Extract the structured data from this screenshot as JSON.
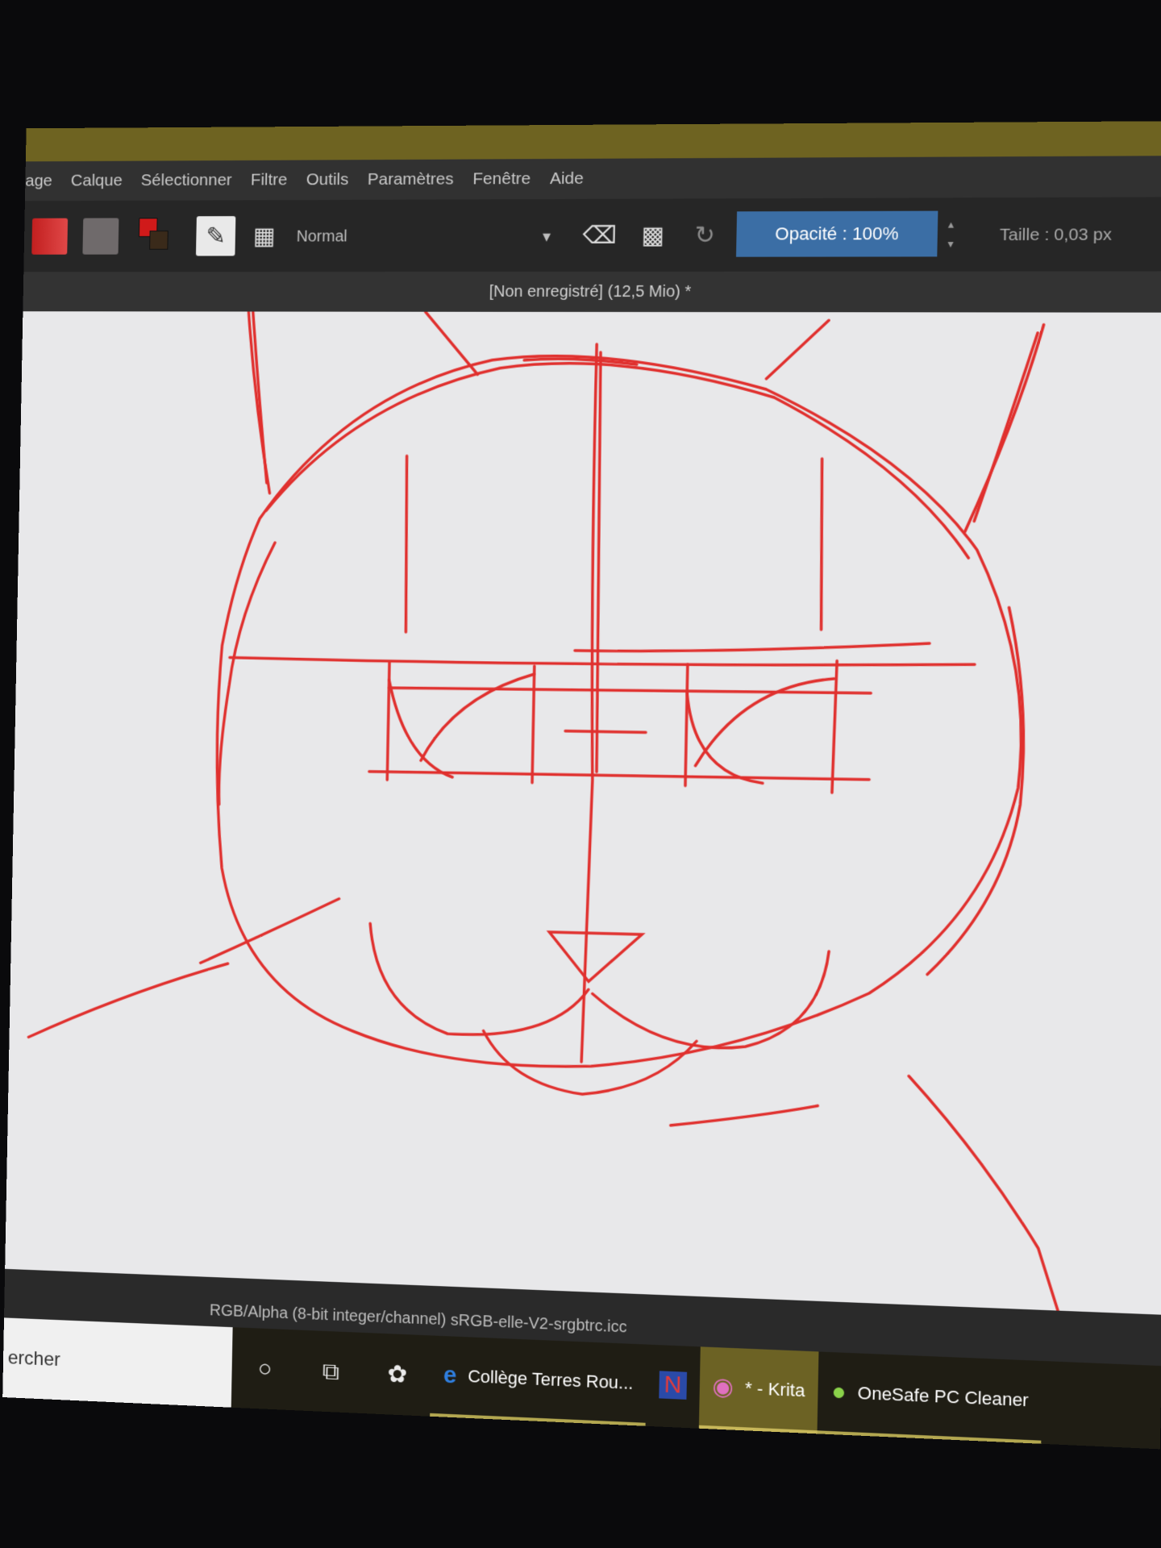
{
  "menubar": {
    "items": [
      "age",
      "Calque",
      "Sélectionner",
      "Filtre",
      "Outils",
      "Paramètres",
      "Fenêtre",
      "Aide"
    ]
  },
  "toolbar": {
    "blend_mode": "Normal",
    "opacity_label": "Opacité : 100%",
    "size_label": "Taille : 0,03 px",
    "icons": [
      "gradient-swatch",
      "pattern-swatch",
      "fg-bg-color-icon",
      "brush-preset-icon",
      "preset-grid-icon",
      "eraser-icon",
      "alpha-lock-icon",
      "reload-icon"
    ]
  },
  "document": {
    "title": "[Non enregistré]  (12,5 Mio) *"
  },
  "colors": {
    "accent": "#6e6321",
    "opacity_bg": "#3b6ea5",
    "stroke": "#e0302e",
    "canvas": "#e8e8ea"
  },
  "statusbar": {
    "color_profile": "RGB/Alpha (8-bit integer/channel)  sRGB-elle-V2-srgbtrc.icc"
  },
  "taskbar": {
    "search_text": "ercher",
    "apps": [
      {
        "label": "Collège Terres Rou...",
        "icon": "edge-icon"
      },
      {
        "label": "",
        "icon": "netflix-icon"
      },
      {
        "label": "* - Krita",
        "icon": "krita-icon"
      },
      {
        "label": "OneSafe PC Cleaner",
        "icon": "onesafe-icon"
      }
    ]
  }
}
